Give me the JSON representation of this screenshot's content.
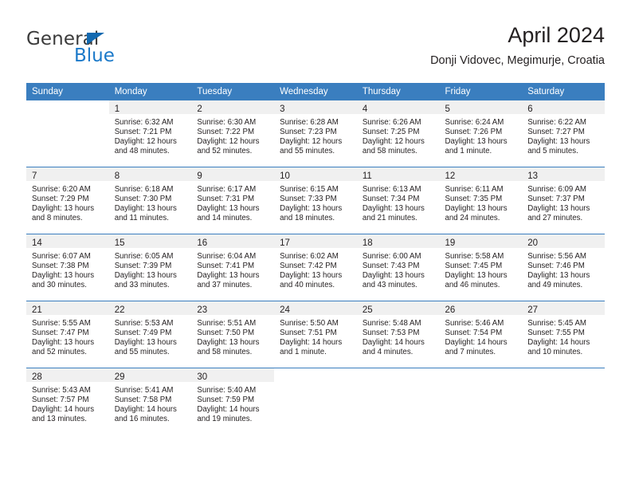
{
  "brand": {
    "name_part1": "General",
    "name_part2": "Blue",
    "triangle_color": "#1269b0",
    "blue_color": "#1b79c9"
  },
  "header": {
    "title": "April 2024",
    "subtitle": "Donji Vidovec, Megimurje, Croatia"
  },
  "theme": {
    "header_row_bg": "#3a7ebf",
    "daynum_band_bg": "#f0f0f0",
    "text_color": "#231f20"
  },
  "calendar": {
    "weekday_headers": [
      "Sunday",
      "Monday",
      "Tuesday",
      "Wednesday",
      "Thursday",
      "Friday",
      "Saturday"
    ],
    "weeks": [
      [
        {
          "day": "",
          "lines": []
        },
        {
          "day": "1",
          "lines": [
            "Sunrise: 6:32 AM",
            "Sunset: 7:21 PM",
            "Daylight: 12 hours",
            "and 48 minutes."
          ]
        },
        {
          "day": "2",
          "lines": [
            "Sunrise: 6:30 AM",
            "Sunset: 7:22 PM",
            "Daylight: 12 hours",
            "and 52 minutes."
          ]
        },
        {
          "day": "3",
          "lines": [
            "Sunrise: 6:28 AM",
            "Sunset: 7:23 PM",
            "Daylight: 12 hours",
            "and 55 minutes."
          ]
        },
        {
          "day": "4",
          "lines": [
            "Sunrise: 6:26 AM",
            "Sunset: 7:25 PM",
            "Daylight: 12 hours",
            "and 58 minutes."
          ]
        },
        {
          "day": "5",
          "lines": [
            "Sunrise: 6:24 AM",
            "Sunset: 7:26 PM",
            "Daylight: 13 hours",
            "and 1 minute."
          ]
        },
        {
          "day": "6",
          "lines": [
            "Sunrise: 6:22 AM",
            "Sunset: 7:27 PM",
            "Daylight: 13 hours",
            "and 5 minutes."
          ]
        }
      ],
      [
        {
          "day": "7",
          "lines": [
            "Sunrise: 6:20 AM",
            "Sunset: 7:29 PM",
            "Daylight: 13 hours",
            "and 8 minutes."
          ]
        },
        {
          "day": "8",
          "lines": [
            "Sunrise: 6:18 AM",
            "Sunset: 7:30 PM",
            "Daylight: 13 hours",
            "and 11 minutes."
          ]
        },
        {
          "day": "9",
          "lines": [
            "Sunrise: 6:17 AM",
            "Sunset: 7:31 PM",
            "Daylight: 13 hours",
            "and 14 minutes."
          ]
        },
        {
          "day": "10",
          "lines": [
            "Sunrise: 6:15 AM",
            "Sunset: 7:33 PM",
            "Daylight: 13 hours",
            "and 18 minutes."
          ]
        },
        {
          "day": "11",
          "lines": [
            "Sunrise: 6:13 AM",
            "Sunset: 7:34 PM",
            "Daylight: 13 hours",
            "and 21 minutes."
          ]
        },
        {
          "day": "12",
          "lines": [
            "Sunrise: 6:11 AM",
            "Sunset: 7:35 PM",
            "Daylight: 13 hours",
            "and 24 minutes."
          ]
        },
        {
          "day": "13",
          "lines": [
            "Sunrise: 6:09 AM",
            "Sunset: 7:37 PM",
            "Daylight: 13 hours",
            "and 27 minutes."
          ]
        }
      ],
      [
        {
          "day": "14",
          "lines": [
            "Sunrise: 6:07 AM",
            "Sunset: 7:38 PM",
            "Daylight: 13 hours",
            "and 30 minutes."
          ]
        },
        {
          "day": "15",
          "lines": [
            "Sunrise: 6:05 AM",
            "Sunset: 7:39 PM",
            "Daylight: 13 hours",
            "and 33 minutes."
          ]
        },
        {
          "day": "16",
          "lines": [
            "Sunrise: 6:04 AM",
            "Sunset: 7:41 PM",
            "Daylight: 13 hours",
            "and 37 minutes."
          ]
        },
        {
          "day": "17",
          "lines": [
            "Sunrise: 6:02 AM",
            "Sunset: 7:42 PM",
            "Daylight: 13 hours",
            "and 40 minutes."
          ]
        },
        {
          "day": "18",
          "lines": [
            "Sunrise: 6:00 AM",
            "Sunset: 7:43 PM",
            "Daylight: 13 hours",
            "and 43 minutes."
          ]
        },
        {
          "day": "19",
          "lines": [
            "Sunrise: 5:58 AM",
            "Sunset: 7:45 PM",
            "Daylight: 13 hours",
            "and 46 minutes."
          ]
        },
        {
          "day": "20",
          "lines": [
            "Sunrise: 5:56 AM",
            "Sunset: 7:46 PM",
            "Daylight: 13 hours",
            "and 49 minutes."
          ]
        }
      ],
      [
        {
          "day": "21",
          "lines": [
            "Sunrise: 5:55 AM",
            "Sunset: 7:47 PM",
            "Daylight: 13 hours",
            "and 52 minutes."
          ]
        },
        {
          "day": "22",
          "lines": [
            "Sunrise: 5:53 AM",
            "Sunset: 7:49 PM",
            "Daylight: 13 hours",
            "and 55 minutes."
          ]
        },
        {
          "day": "23",
          "lines": [
            "Sunrise: 5:51 AM",
            "Sunset: 7:50 PM",
            "Daylight: 13 hours",
            "and 58 minutes."
          ]
        },
        {
          "day": "24",
          "lines": [
            "Sunrise: 5:50 AM",
            "Sunset: 7:51 PM",
            "Daylight: 14 hours",
            "and 1 minute."
          ]
        },
        {
          "day": "25",
          "lines": [
            "Sunrise: 5:48 AM",
            "Sunset: 7:53 PM",
            "Daylight: 14 hours",
            "and 4 minutes."
          ]
        },
        {
          "day": "26",
          "lines": [
            "Sunrise: 5:46 AM",
            "Sunset: 7:54 PM",
            "Daylight: 14 hours",
            "and 7 minutes."
          ]
        },
        {
          "day": "27",
          "lines": [
            "Sunrise: 5:45 AM",
            "Sunset: 7:55 PM",
            "Daylight: 14 hours",
            "and 10 minutes."
          ]
        }
      ],
      [
        {
          "day": "28",
          "lines": [
            "Sunrise: 5:43 AM",
            "Sunset: 7:57 PM",
            "Daylight: 14 hours",
            "and 13 minutes."
          ]
        },
        {
          "day": "29",
          "lines": [
            "Sunrise: 5:41 AM",
            "Sunset: 7:58 PM",
            "Daylight: 14 hours",
            "and 16 minutes."
          ]
        },
        {
          "day": "30",
          "lines": [
            "Sunrise: 5:40 AM",
            "Sunset: 7:59 PM",
            "Daylight: 14 hours",
            "and 19 minutes."
          ]
        },
        {
          "day": "",
          "lines": []
        },
        {
          "day": "",
          "lines": []
        },
        {
          "day": "",
          "lines": []
        },
        {
          "day": "",
          "lines": []
        }
      ]
    ]
  }
}
